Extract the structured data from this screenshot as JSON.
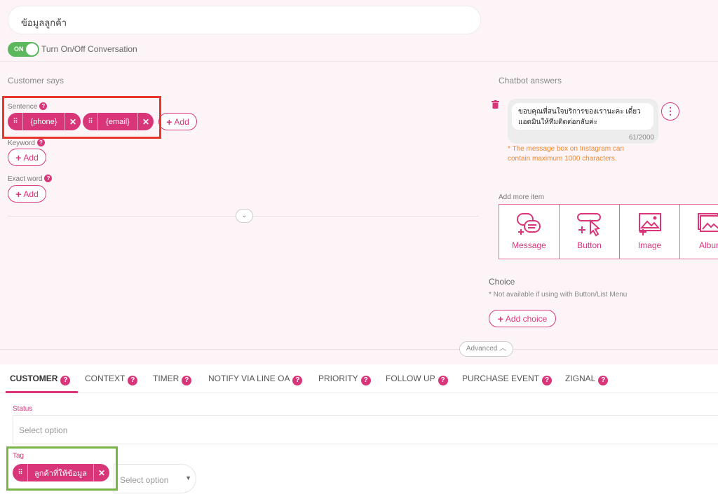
{
  "intent": {
    "name": "ข้อมูลลูกค้า"
  },
  "toggle": {
    "state": "ON",
    "label": "Turn On/Off Conversation"
  },
  "customer_says": {
    "title": "Customer says",
    "sentence": {
      "label": "Sentence",
      "tags": [
        "{phone}",
        "{email}"
      ],
      "add_label": "Add"
    },
    "keyword": {
      "label": "Keyword",
      "add_label": "Add"
    },
    "exact_word": {
      "label": "Exact word",
      "add_label": "Add"
    }
  },
  "chatbot_answers": {
    "title": "Chatbot answers",
    "message": "ขอบคุณที่สนใจบริการของเรานะคะ เดี๋ยวแอดมินให้ทีมติดต่อกลับค่ะ",
    "char_count": "61/2000",
    "instagram_note": "* The message box on Instagram can contain maximum 1000 characters.",
    "add_more_label": "Add more item",
    "items": [
      "Message",
      "Button",
      "Image",
      "Album"
    ]
  },
  "choice": {
    "title": "Choice",
    "note": "* Not available if using with Button/List Menu",
    "add_label": "Add choice"
  },
  "advanced": {
    "label": "Advanced"
  },
  "tabs": [
    "CUSTOMER",
    "CONTEXT",
    "TIMER",
    "NOTIFY VIA LINE OA",
    "PRIORITY",
    "FOLLOW UP",
    "PURCHASE EVENT",
    "ZIGNAL"
  ],
  "customer_tab": {
    "status": {
      "label": "Status",
      "placeholder": "Select option"
    },
    "tag": {
      "label": "Tag",
      "chip": "ลูกค้าที่ให้ข้อมูล",
      "placeholder": "Select option"
    }
  },
  "colors": {
    "accent": "#d9367a",
    "toggle_on": "#5cb85c",
    "red_highlight": "#e8362c",
    "green_highlight": "#77b545",
    "note_orange": "#f0882a"
  }
}
